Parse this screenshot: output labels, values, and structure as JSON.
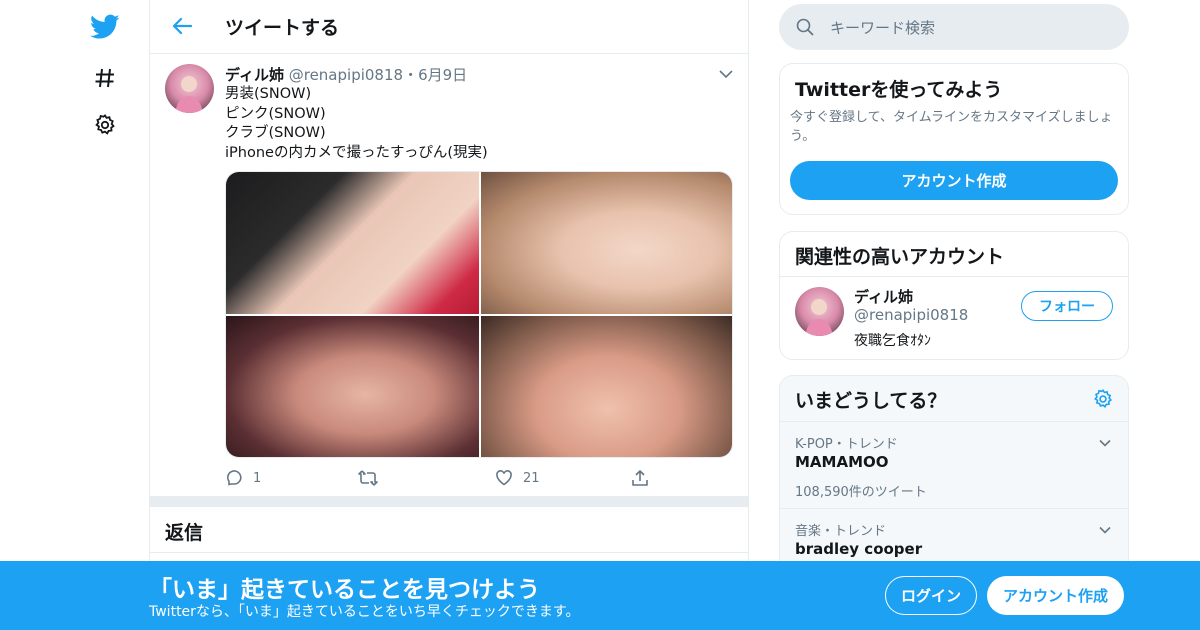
{
  "colors": {
    "accent": "#1da1f2",
    "muted": "#657786",
    "border": "#e6ecf0",
    "banner": "#1da1f2"
  },
  "nav": {
    "icons": [
      "twitter-bird-icon",
      "hashtag-icon",
      "gear-icon"
    ]
  },
  "header": {
    "title": "ツイートする",
    "back_icon": "back-arrow-icon"
  },
  "tweet": {
    "name": "ディル姉",
    "handle": "@renapipi0818",
    "separator": "・",
    "date": "6月9日",
    "lines": [
      "男装(SNOW)",
      "ピンク(SNOW)",
      "クラブ(SNOW)",
      "iPhoneの内カメで撮ったすっぴん(現実)"
    ],
    "media_count": 4,
    "actions": {
      "reply_count": "1",
      "retweet_count": "",
      "like_count": "21"
    }
  },
  "replies": {
    "title": "返信"
  },
  "search": {
    "placeholder": "キーワード検索"
  },
  "signup_card": {
    "title": "Twitterを使ってみよう",
    "description": "今すぐ登録して、タイムラインをカスタマイズしましょう。",
    "button": "アカウント作成"
  },
  "related_card": {
    "title": "関連性の高いアカウント",
    "name": "ディル姉",
    "handle": "@renapipi0818",
    "bio": "夜職乞食ｵﾀﾝ",
    "follow_button": "フォロー"
  },
  "trends_card": {
    "title": "いまどうしてる？",
    "items": [
      {
        "meta": "K-POP・トレンド",
        "name": "MAMAMOO",
        "count": "108,590件のツイート"
      },
      {
        "meta": "音楽・トレンド",
        "name": "bradley cooper",
        "count": ""
      }
    ]
  },
  "banner": {
    "title": "「いま」起きていることを見つけよう",
    "subtitle": "Twitterなら、「いま」起きていることをいち早くチェックできます。",
    "login": "ログイン",
    "signup": "アカウント作成"
  }
}
